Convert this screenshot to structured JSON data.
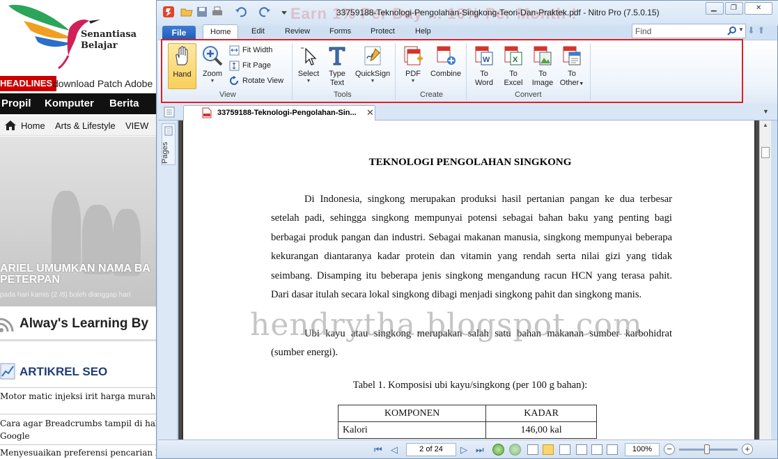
{
  "blog": {
    "logo_line1": "Senantiasa",
    "logo_line2": "Belajar",
    "headlines_tag": "HEADLINES",
    "headline_text": "download Patch Adobe",
    "nav_items": [
      "Propil",
      "Komputer",
      "Berita"
    ],
    "subnav_items": [
      "Home",
      "Arts & Lifestyle",
      "VIEW"
    ],
    "banner_title": "ARIEL UMUMKAN NAMA BA PETERPAN",
    "banner_sub": "pada hari kamis (2 /8) boleh dianggap hari",
    "section1": "Alway's Learning By",
    "section2": "ARTIKREL SEO",
    "posts": [
      "Motor matic injeksi irit harga murah – Ya",
      "Cara agar Breadcrumbs tampil di halama",
      "Google",
      "Menyesuaikan preferensi pencarian blog"
    ]
  },
  "window": {
    "title": "33759188-Teknologi-Pengolahan-Singkong-Teori-Dan-Praktek.pdf - Nitro Pro (7.5.0.15)",
    "watermark_top": "Earn 1% Per Day ... 10% Per Month !"
  },
  "ribbon_tabs": [
    "File",
    "Home",
    "Edit",
    "Review",
    "Forms",
    "Protect",
    "Help"
  ],
  "find": {
    "placeholder": "Find"
  },
  "ribbon": {
    "view": {
      "label": "View",
      "hand": "Hand",
      "zoom": "Zoom",
      "fit_width": "Fit Width",
      "fit_page": "Fit Page",
      "rotate_view": "Rotate View"
    },
    "tools": {
      "label": "Tools",
      "select": "Select",
      "type_text_1": "Type",
      "type_text_2": "Text",
      "quicksign": "QuickSign"
    },
    "create": {
      "label": "Create",
      "pdf": "PDF",
      "combine": "Combine"
    },
    "convert": {
      "label": "Convert",
      "to_word_1": "To",
      "to_word_2": "Word",
      "to_excel_1": "To",
      "to_excel_2": "Excel",
      "to_image_1": "To",
      "to_image_2": "Image",
      "to_other_1": "To",
      "to_other_2": "Other"
    }
  },
  "doc_tab": {
    "name": "33759188-Teknologi-Pengolahan-Sin..."
  },
  "side_panel": {
    "pages_label": "Pages"
  },
  "document": {
    "title": "TEKNOLOGI PENGOLAHAN SINGKONG",
    "para1": "Di Indonesia, singkong merupakan produksi hasil pertanian pangan ke dua terbesar setelah padi, sehingga singkong mempunyai potensi sebagai bahan baku yang penting bagi berbagai produk pangan dan industri. Sebagai makanan manusia, singkong mempunyai beberapa kekurangan diantaranya kadar protein dan vitamin yang rendah serta nilai gizi yang tidak seimbang. Disamping itu beberapa jenis singkong mengandung racun HCN yang terasa pahit. Dari dasar itulah secara lokal singkong dibagi menjadi singkong pahit dan singkong manis.",
    "para2": "Ubi kayu atau singkong merupakan salah satu bahan makanan sumber karbohidrat (sumber energi).",
    "table_caption": "Tabel 1.  Komposisi ubi kayu/singkong (per 100 g bahan):",
    "table_headers": [
      "KOMPONEN",
      "KADAR"
    ],
    "table_rows": [
      [
        "Kalori",
        "146,00 kal"
      ]
    ],
    "watermark": "hendrytha.blogspot.com"
  },
  "status": {
    "page_indicator": "2 of 24",
    "zoom_level": "100%"
  }
}
